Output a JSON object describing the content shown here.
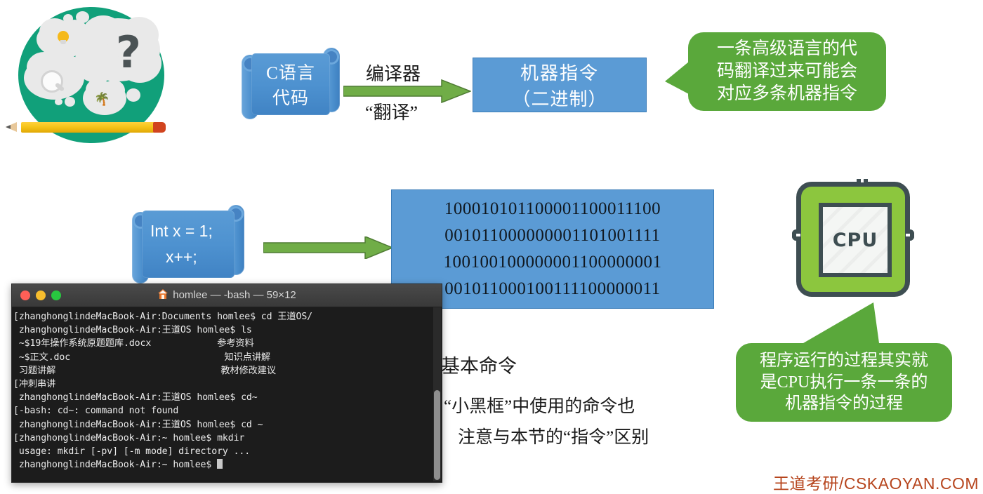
{
  "slide": {
    "title_watermark": "王道考研/CSKAOYAN.COM",
    "colors": {
      "blue_box": "#5b9bd5",
      "scroll_blue": "#4e92d0",
      "callout_green": "#5aa83b",
      "arrow_green": "#70ad47",
      "brainstorm_teal": "#11a07a",
      "cpu_green": "#8cc63e",
      "cpu_dark": "#3e4e52",
      "watermark": "#b6441c"
    }
  },
  "brainstorm": {
    "icon": "brainstorm-thought-bubbles-icon",
    "question_mark": "?",
    "palm_glyph": "🌴"
  },
  "row1": {
    "source_scroll": {
      "line1": "C语言",
      "line2": "代码"
    },
    "arrow_label_top": "编译器",
    "arrow_label_bottom": "“翻译”",
    "target_box": {
      "line1": "机器指令",
      "line2": "（二进制）"
    },
    "callout": {
      "line1": "一条高级语言的代",
      "line2": "码翻译过来可能会",
      "line3": "对应多条机器指令"
    }
  },
  "row2": {
    "code_scroll": {
      "line1": "Int x = 1;",
      "line2": "x++;"
    },
    "binary_box": {
      "lines": [
        "100010101100001100011100",
        "001011000000001101001111",
        "100100100000001100000001",
        "001011000100111100000011"
      ]
    },
    "cpu": {
      "label": "CPU",
      "icon": "cpu-chip-icon"
    },
    "cpu_callout": {
      "line1": "程序运行的过程其实就",
      "line2": "是CPU执行一条一条的",
      "line3": "机器指令的过程"
    }
  },
  "notes": {
    "partial_line": "最基本命令",
    "note_line1": "“小黑框”中使用的命令也",
    "note_line2": "注意与本节的“指令”区别"
  },
  "terminal": {
    "title": "homlee — -bash — 59×12",
    "home_icon": "home-icon",
    "traffic_lights": [
      "close-red",
      "minimize-yellow",
      "zoom-green"
    ],
    "lines": [
      "[zhanghonglindeMacBook-Air:Documents homlee$ cd 王道OS/",
      " zhanghonglindeMacBook-Air:王道OS homlee$ ls",
      " ~$19年操作系统原题题库.docx            参考资料",
      " ~$正文.doc                            知识点讲解",
      " 习题讲解                              教材修改建议",
      "[冲刺串讲",
      " zhanghonglindeMacBook-Air:王道OS homlee$ cd~",
      "[-bash: cd~: command not found",
      " zhanghonglindeMacBook-Air:王道OS homlee$ cd ~",
      "[zhanghonglindeMacBook-Air:~ homlee$ mkdir",
      " usage: mkdir [-pv] [-m mode] directory ...",
      " zhanghonglindeMacBook-Air:~ homlee$ "
    ]
  }
}
